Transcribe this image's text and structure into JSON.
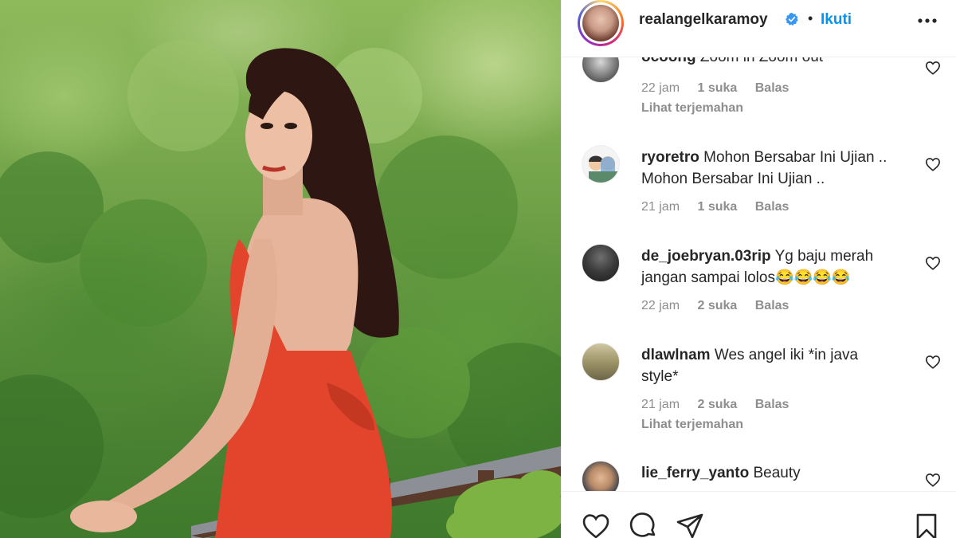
{
  "post": {
    "photo_description_icon": "photo-of-woman-in-red-dress"
  },
  "header": {
    "username": "realangelkaramoy",
    "verified_icon": "verified-badge-icon",
    "separator": "•",
    "follow_label": "Ikuti",
    "more_icon": "more-options-icon"
  },
  "comments": [
    {
      "user": "ocoong",
      "text": "Zoom in Zoom out",
      "time": "22 jam",
      "likes": "1 suka",
      "reply": "Balas",
      "translate": "Lihat terjemahan"
    },
    {
      "user": "ryoretro",
      "text": "Mohon Bersabar Ini Ujian .. Mohon Bersabar Ini Ujian ..",
      "time": "21 jam",
      "likes": "1 suka",
      "reply": "Balas",
      "translate": ""
    },
    {
      "user": "de_joebryan.03rip",
      "text": "Yg baju merah jangan sampai lolos😂😂😂😂",
      "time": "22 jam",
      "likes": "2 suka",
      "reply": "Balas",
      "translate": ""
    },
    {
      "user": "dlawlnam",
      "text": "Wes angel iki *in java style*",
      "time": "21 jam",
      "likes": "2 suka",
      "reply": "Balas",
      "translate": "Lihat terjemahan"
    },
    {
      "user": "lie_ferry_yanto",
      "text": "Beauty",
      "time": "",
      "likes": "",
      "reply": "",
      "translate": ""
    }
  ],
  "actions": {
    "like_icon": "heart-icon",
    "comment_icon": "comment-icon",
    "share_icon": "share-icon",
    "save_icon": "bookmark-icon"
  },
  "colors": {
    "link_blue": "#0095f6",
    "text_dark": "#262626",
    "text_muted": "#8e8e8e",
    "verified_blue": "#3897f0",
    "dress_red": "#e2452b"
  }
}
